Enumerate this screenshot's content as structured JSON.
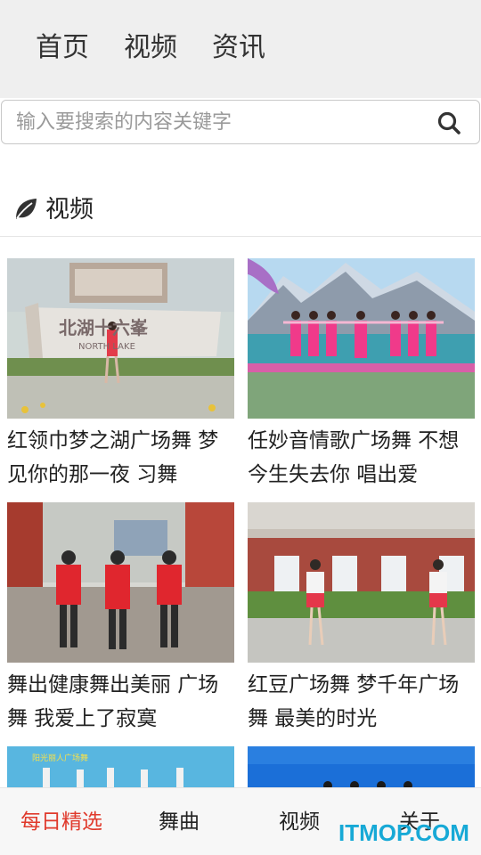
{
  "top_nav": {
    "tabs": [
      {
        "label": "首页"
      },
      {
        "label": "视频"
      },
      {
        "label": "资讯"
      }
    ]
  },
  "search": {
    "placeholder": "输入要搜索的内容关键字",
    "value": "",
    "icon": "search-icon"
  },
  "section": {
    "icon": "leaf-icon",
    "title": "视频"
  },
  "videos": [
    {
      "caption": "红领巾梦之湖广场舞 梦见你的那一夜 习舞",
      "thumb_text": "北湖十六峯",
      "thumb_badge": "NORTH LAKE"
    },
    {
      "caption": "任妙音情歌广场舞 不想今生失去你 唱出爱"
    },
    {
      "caption": "舞出健康舞出美丽 广场舞 我爱上了寂寞"
    },
    {
      "caption": "红豆广场舞 梦千年广场舞 最美的时光"
    },
    {
      "caption": "",
      "thumb_text": "阳光丽人广场舞"
    },
    {
      "caption": ""
    }
  ],
  "bottom_nav": {
    "tabs": [
      {
        "label": "每日精选",
        "active": true
      },
      {
        "label": "舞曲"
      },
      {
        "label": "视频"
      },
      {
        "label": "关于"
      }
    ],
    "active_color": "#e03a2c"
  },
  "watermark": "ITMOP.COM"
}
